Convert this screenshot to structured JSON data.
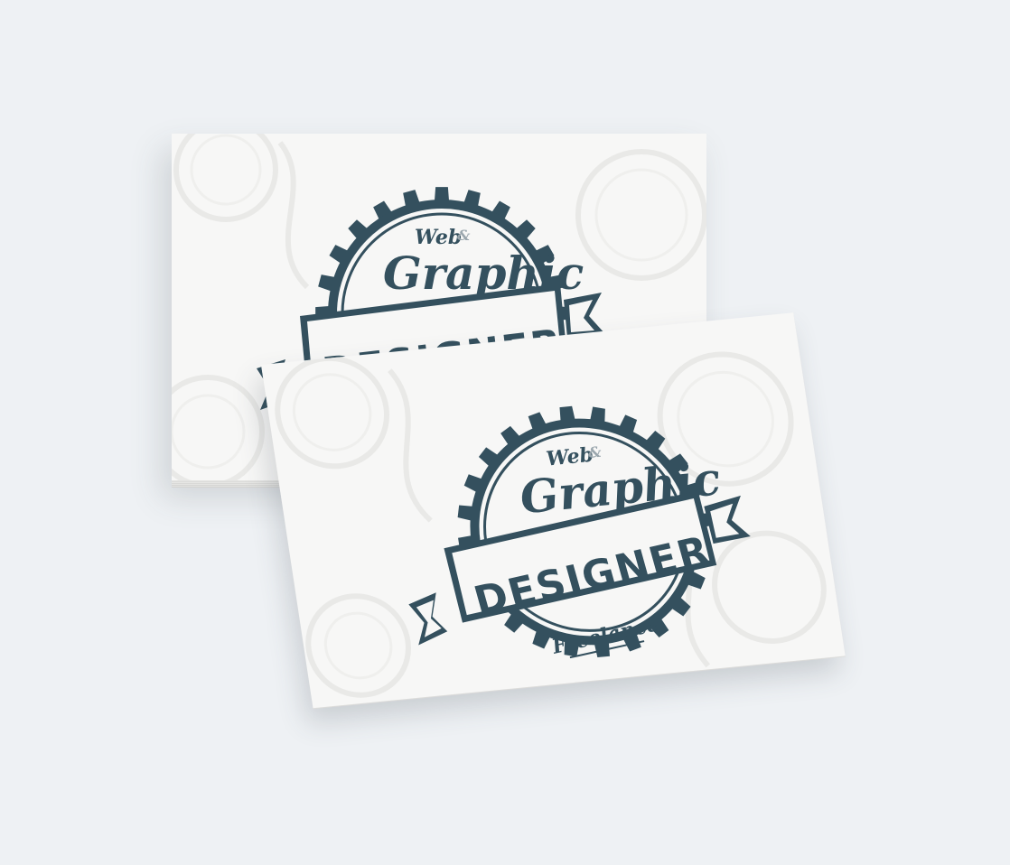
{
  "image": {
    "background_color": "#eef1f4",
    "card_color": "#f7f7f6",
    "ink_color": "#34505e"
  },
  "badge": {
    "line1_prefix": "Web",
    "line1_symbol": "&",
    "line2": "Graphic",
    "banner": "DESIGNER",
    "footer": "Freelance"
  }
}
